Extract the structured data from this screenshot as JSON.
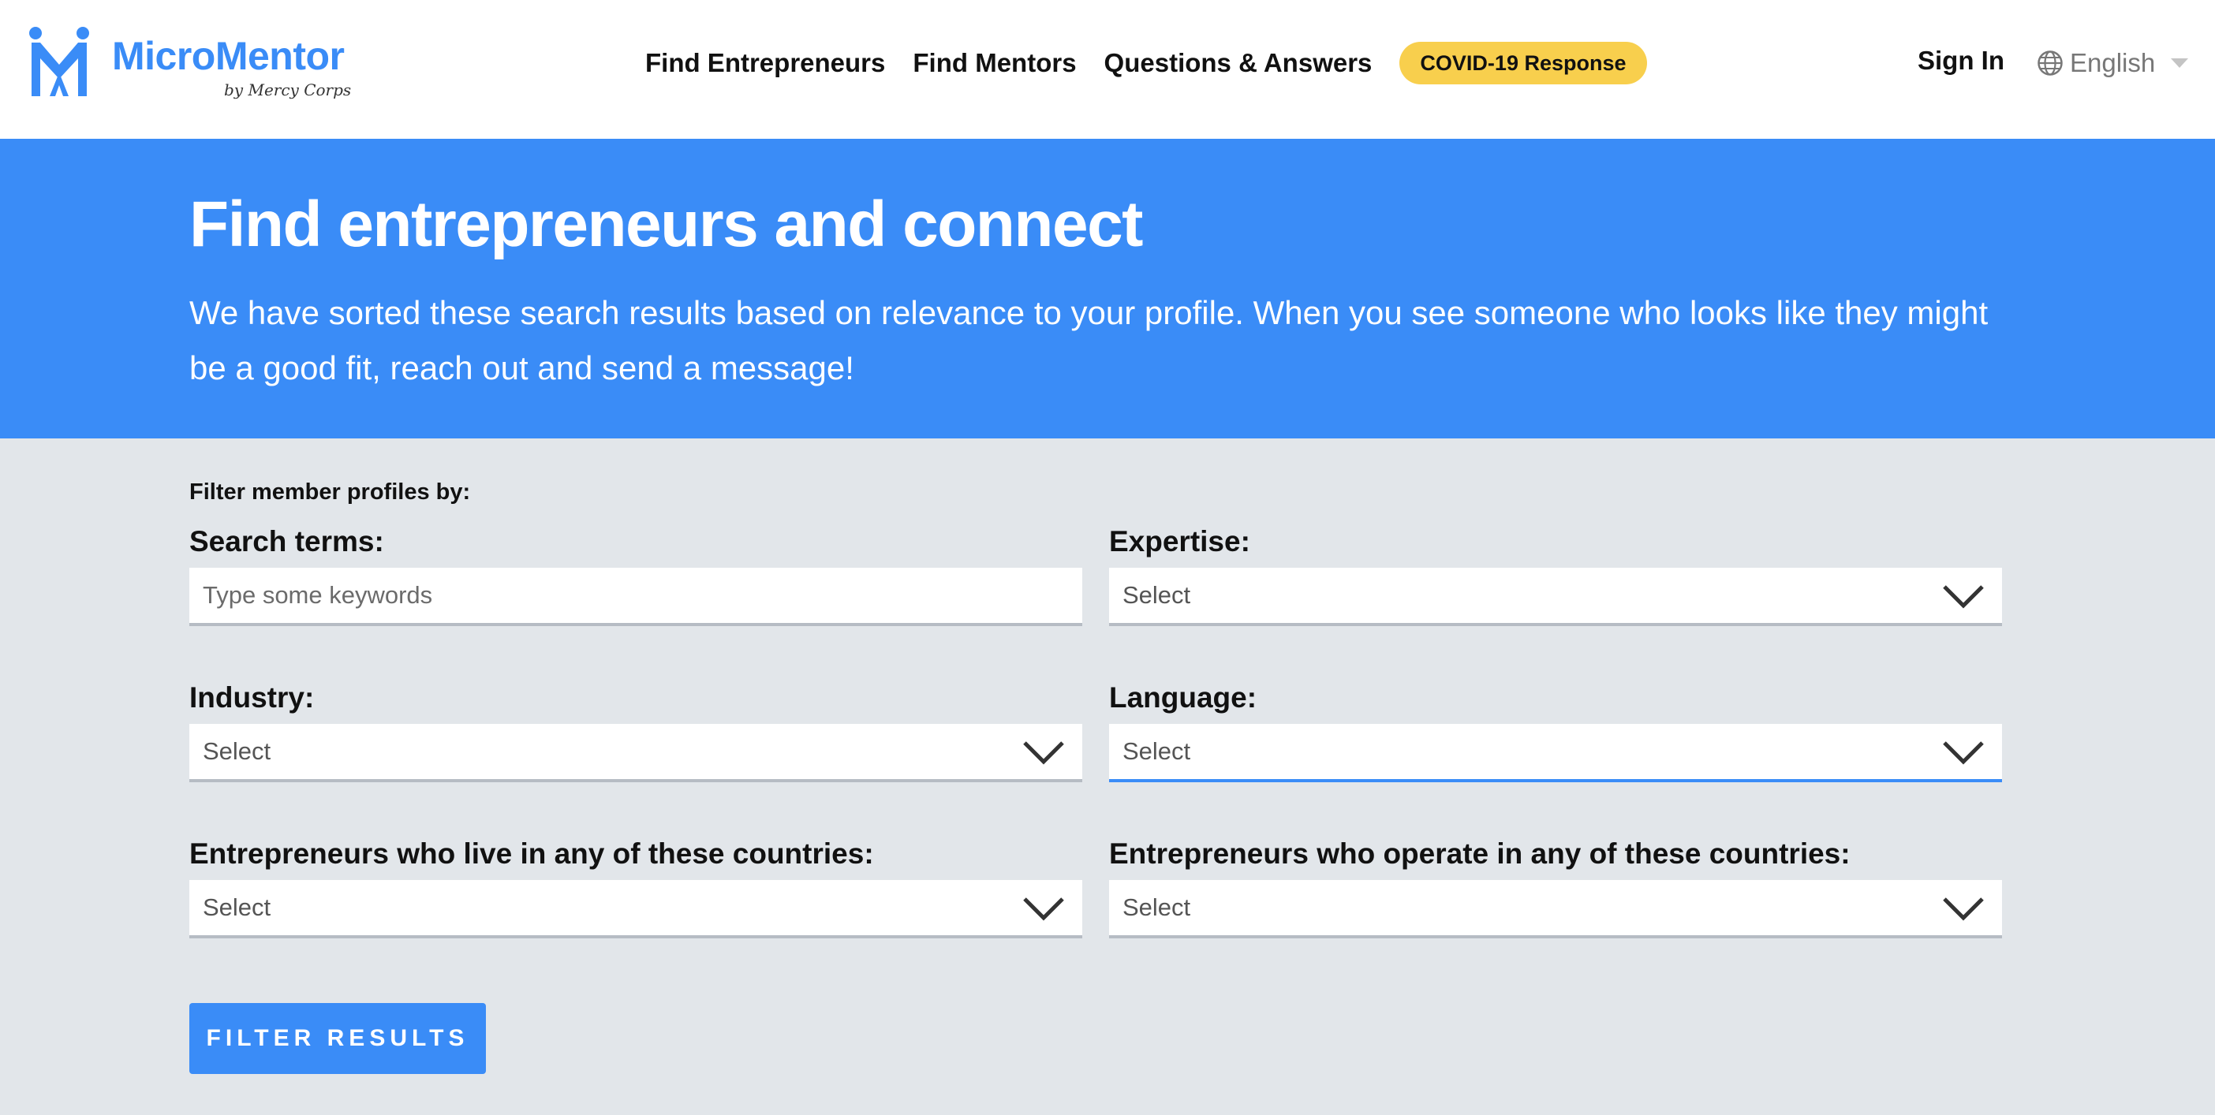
{
  "header": {
    "logo_name": "MicroMentor",
    "logo_sub": "by Mercy Corps",
    "nav": [
      {
        "label": "Find Entrepreneurs"
      },
      {
        "label": "Find Mentors"
      },
      {
        "label": "Questions & Answers"
      }
    ],
    "covid_label": "COVID-19 Response",
    "signin_label": "Sign In",
    "language": "English",
    "colors": {
      "brand": "#3a8cf7",
      "covid": "#f8cf4d"
    }
  },
  "hero": {
    "title": "Find entrepreneurs and connect",
    "text": "We have sorted these search results based on relevance to your profile. When you see someone who looks like they might be a good fit, reach out and send a message!"
  },
  "filter": {
    "caption": "Filter member profiles by:",
    "search": {
      "label": "Search terms:",
      "placeholder": "Type some keywords",
      "value": ""
    },
    "expertise": {
      "label": "Expertise:",
      "value": "Select"
    },
    "industry": {
      "label": "Industry:",
      "value": "Select"
    },
    "language": {
      "label": "Language:",
      "value": "Select"
    },
    "live_countries": {
      "label": "Entrepreneurs who live in any of these countries:",
      "value": "Select"
    },
    "operate_countries": {
      "label": "Entrepreneurs who operate in any of these countries:",
      "value": "Select"
    },
    "button_label": "FILTER RESULTS"
  }
}
